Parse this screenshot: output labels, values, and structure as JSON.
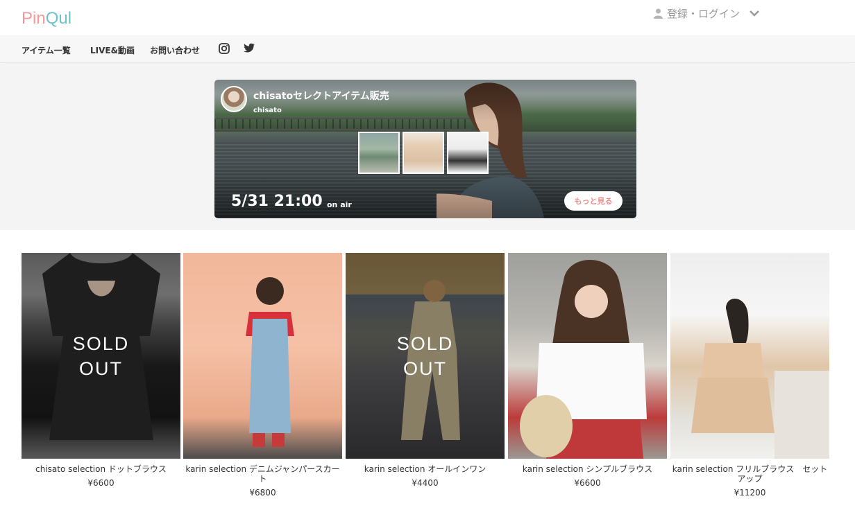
{
  "header": {
    "logo_part1": "Pin",
    "logo_part2": "Qul",
    "login_label": "登録・ログイン"
  },
  "nav": {
    "items": [
      {
        "label": "アイテム一覧"
      },
      {
        "label": "LIVE&動画"
      },
      {
        "label": "お問い合わせ"
      }
    ],
    "icons": [
      "instagram-icon",
      "twitter-icon"
    ]
  },
  "banner": {
    "title": "chisatoセレクトアイテム販売",
    "subtitle": "chisato",
    "date": "5/31 21:00",
    "on_air": "on air",
    "more_button": "もっと見る"
  },
  "products": [
    {
      "name": "chisato selection ドットブラウス",
      "price": "¥6600",
      "sold_out": "SOLD\nOUT"
    },
    {
      "name": "karin selection デニムジャンパースカート",
      "price": "¥6800",
      "sold_out": ""
    },
    {
      "name": "karin selection オールインワン",
      "price": "¥4400",
      "sold_out": "SOLD\nOUT"
    },
    {
      "name": "karin selection シンプルブラウス",
      "price": "¥6600",
      "sold_out": ""
    },
    {
      "name": "karin selection フリルブラウス　セットアップ",
      "price": "¥11200",
      "sold_out": ""
    }
  ],
  "colors": {
    "logo_pink": "#f29a9a",
    "logo_teal": "#6cc3c9",
    "accent": "#f08c8c",
    "nav_bg": "#f7f7f7"
  }
}
